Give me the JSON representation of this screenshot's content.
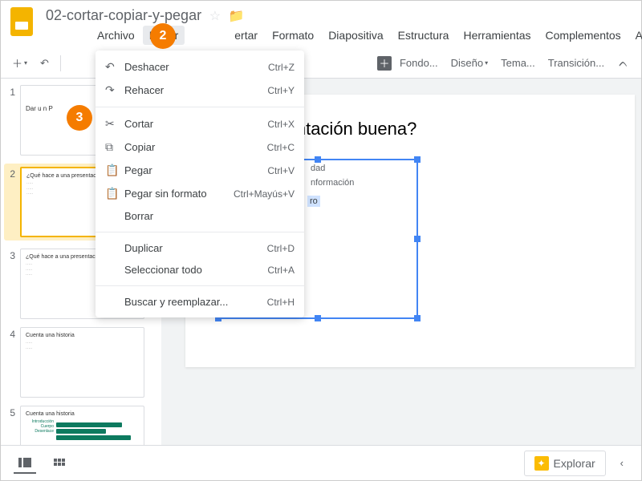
{
  "doc": {
    "title": "02-cortar-copiar-y-pegar"
  },
  "menubar": [
    "Archivo",
    "Editar",
    "ertar",
    "Formato",
    "Diapositiva",
    "Estructura",
    "Herramientas",
    "Complementos",
    "Ayuda"
  ],
  "toolbar": {
    "fondo": "Fondo...",
    "diseno": "Diseño",
    "tema": "Tema...",
    "transicion": "Transición..."
  },
  "dropdown": {
    "items": [
      {
        "icon": "↶",
        "label": "Deshacer",
        "shortcut": "Ctrl+Z"
      },
      {
        "icon": "↷",
        "label": "Rehacer",
        "shortcut": "Ctrl+Y"
      },
      "sep",
      {
        "icon": "✂",
        "label": "Cortar",
        "shortcut": "Ctrl+X"
      },
      {
        "icon": "⧉",
        "label": "Copiar",
        "shortcut": "Ctrl+C"
      },
      {
        "icon": "📋",
        "label": "Pegar",
        "shortcut": "Ctrl+V"
      },
      {
        "icon": "📋",
        "label": "Pegar sin formato",
        "shortcut": "Ctrl+Mayús+V"
      },
      {
        "icon": "",
        "label": "Borrar",
        "shortcut": ""
      },
      "sep",
      {
        "icon": "",
        "label": "Duplicar",
        "shortcut": "Ctrl+D"
      },
      {
        "icon": "",
        "label": "Seleccionar todo",
        "shortcut": "Ctrl+A"
      },
      "sep",
      {
        "icon": "",
        "label": "Buscar y reemplazar...",
        "shortcut": "Ctrl+H"
      }
    ]
  },
  "canvas": {
    "title": "una presentación buena?",
    "line1": "dad",
    "line2": "nformación",
    "highlight": "ro"
  },
  "thumbs": {
    "t1": "Dar u      n P",
    "t2": "¿Qué hace a una presentaci",
    "t3": "¿Qué hace a una presentaci",
    "t4": "Cuenta una historia",
    "t5": "Cuenta una historia",
    "t5a": "Introducción",
    "t5b": "Cuerpo",
    "t5c": "Desenlace"
  },
  "callouts": {
    "c2": "2",
    "c3": "3"
  },
  "explore": "Explorar"
}
